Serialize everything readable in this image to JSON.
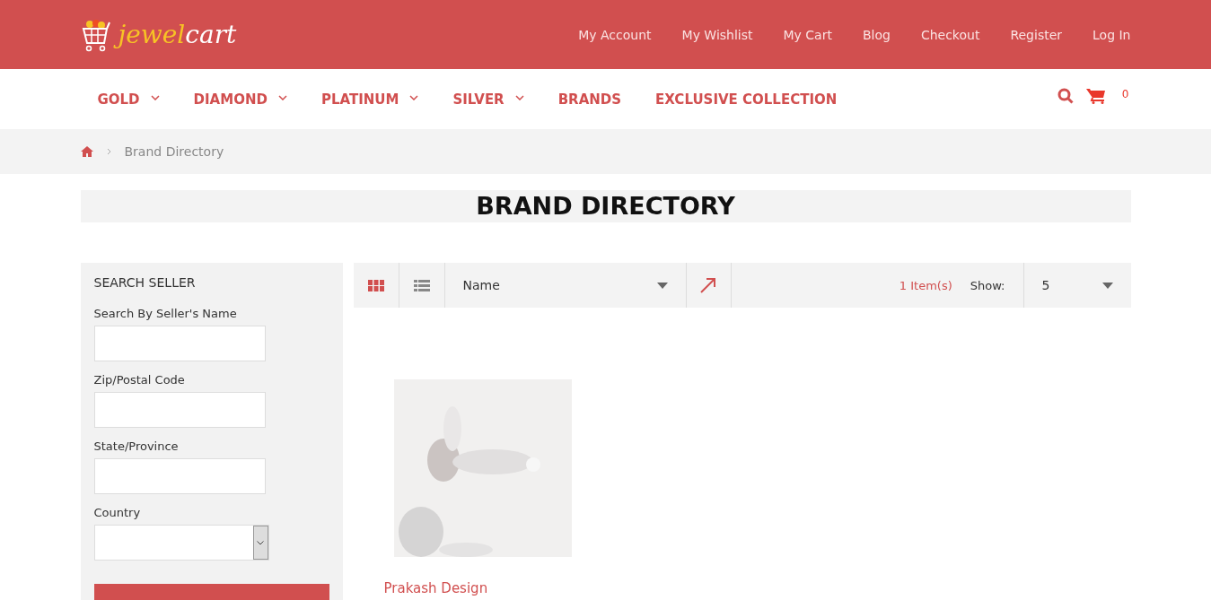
{
  "header": {
    "logo": {
      "first": "jewel",
      "second": "cart"
    },
    "links": [
      "My Account",
      "My Wishlist",
      "My Cart",
      "Blog",
      "Checkout",
      "Register",
      "Log In"
    ]
  },
  "nav": {
    "items": [
      {
        "label": "GOLD",
        "has_dropdown": true
      },
      {
        "label": "DIAMOND",
        "has_dropdown": true
      },
      {
        "label": "PLATINUM",
        "has_dropdown": true
      },
      {
        "label": "SILVER",
        "has_dropdown": true
      },
      {
        "label": "BRANDS",
        "has_dropdown": false
      },
      {
        "label": "EXCLUSIVE COLLECTION",
        "has_dropdown": false
      }
    ],
    "cart_count": "0"
  },
  "breadcrumb": {
    "items": [
      "Brand Directory"
    ]
  },
  "page_title": "BRAND DIRECTORY",
  "sidebar": {
    "title": "SEARCH SELLER",
    "fields": [
      {
        "label": "Search By Seller's Name",
        "kind": "text"
      },
      {
        "label": "Zip/Postal Code",
        "kind": "text"
      },
      {
        "label": "State/Province",
        "kind": "text"
      },
      {
        "label": "Country",
        "kind": "select"
      }
    ]
  },
  "toolbar": {
    "view_modes": [
      {
        "kind": "grid",
        "selected": true
      },
      {
        "kind": "list",
        "selected": false
      }
    ],
    "sort_by": "Name",
    "item_count": "1 Item(s)",
    "show_label": "Show:",
    "show_value": "5"
  },
  "products": [
    {
      "name": "Prakash Design",
      "kind": "picture"
    }
  ]
}
